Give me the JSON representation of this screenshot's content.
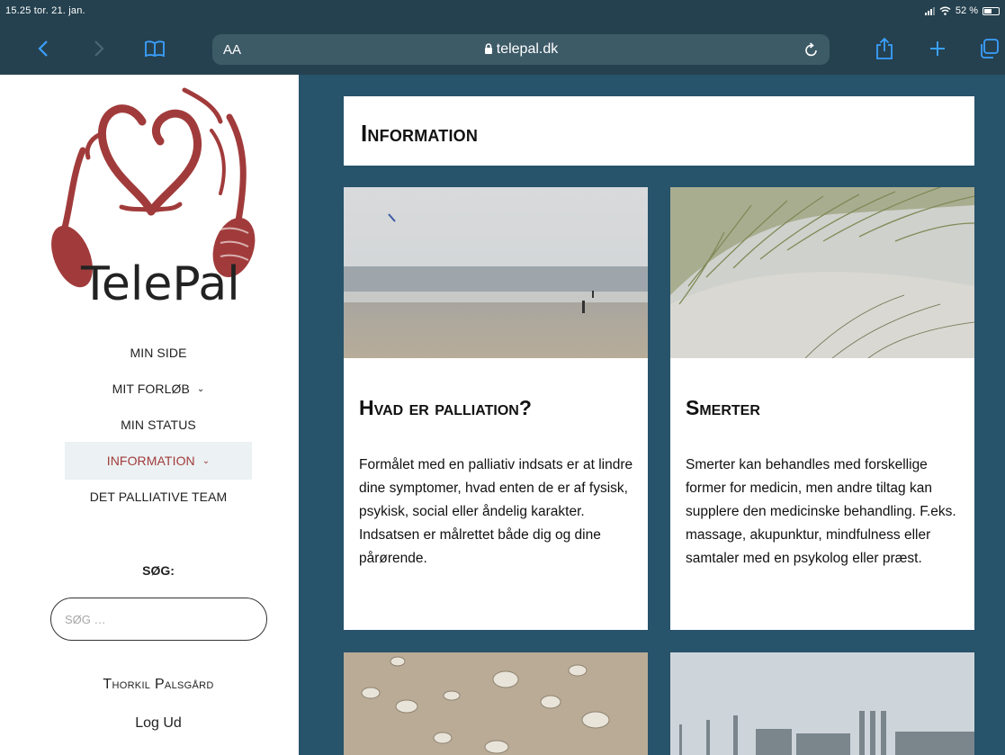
{
  "status_bar": {
    "time_date": "15.25  tor. 21. jan.",
    "battery": "52 %",
    "battery_level": 0.52
  },
  "browser": {
    "text_size_label": "AA",
    "url": "telepal.dk",
    "icons": [
      "back-icon",
      "forward-icon",
      "bookmarks-icon",
      "lock-icon",
      "reload-icon",
      "share-icon",
      "new-tab-icon",
      "tabs-icon"
    ]
  },
  "sidebar": {
    "logo_text": "TelePal",
    "nav": [
      {
        "label": "MIN SIDE"
      },
      {
        "label": "MIT FORLØB"
      },
      {
        "label": "MIN STATUS"
      },
      {
        "label": "INFORMATION"
      },
      {
        "label": "DET PALLIATIVE TEAM"
      }
    ],
    "search_label": "SØG:",
    "search_placeholder": "SØG …",
    "user_name": "Thorkil Palsgård",
    "logout": "Log Ud"
  },
  "main": {
    "page_title": "Information",
    "cards": [
      {
        "title": "Hvad er palliation?",
        "text": "Formålet med en palliativ indsats er at lindre dine symptomer, hvad enten de er af fysisk, psykisk, social eller åndelig karakter. Indsatsen er målrettet både dig og dine pårørende."
      },
      {
        "title": "Smerter",
        "text": "Smerter kan behandles med forskellige former for medicin, men andre tiltag kan supplere den medicinske behandling. F.eks. massage, akupunktur, mindfulness eller samtaler med en psykolog eller præst."
      },
      {
        "title": "",
        "text": ""
      },
      {
        "title": "",
        "text": ""
      }
    ]
  },
  "colors": {
    "chrome": "#25414f",
    "main_bg": "#27536b",
    "accent_red": "#a13b3b",
    "active_nav_bg": "#ecf1f3"
  }
}
